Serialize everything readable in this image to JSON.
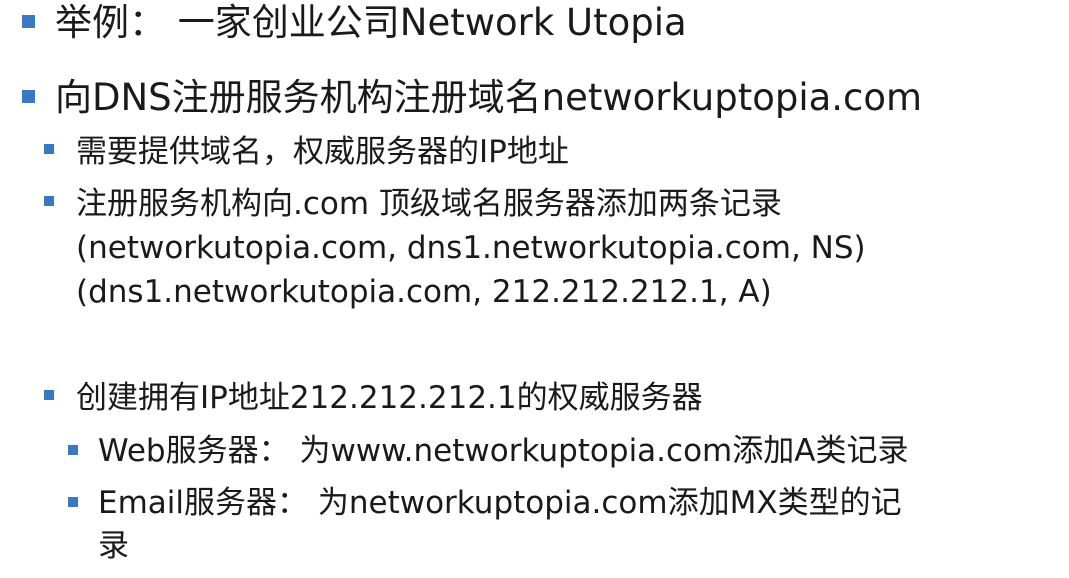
{
  "colors": {
    "bullet": "#3a78c2",
    "text": "#1a1a1a",
    "background": "#ffffff"
  },
  "items": [
    {
      "level": 1,
      "text": "举例： 一家创业公司Network Utopia"
    },
    {
      "level": 1,
      "text": "向DNS注册服务机构注册域名networkuptopia.com"
    },
    {
      "level": 2,
      "text": "需要提供域名，权威服务器的IP地址"
    },
    {
      "level": 2,
      "text": "注册服务机构向.com 顶级域名服务器添加两条记录",
      "continuation": [
        "(networkutopia.com, dns1.networkutopia.com, NS)",
        "(dns1.networkutopia.com, 212.212.212.1, A)"
      ]
    },
    {
      "level": 2,
      "text": "创建拥有IP地址212.212.212.1的权威服务器"
    },
    {
      "level": 3,
      "text": "Web服务器： 为www.networkuptopia.com添加A类记录"
    },
    {
      "level": 3,
      "text": "Email服务器： 为networkuptopia.com添加MX类型的记",
      "continuation": [
        "录"
      ]
    }
  ]
}
